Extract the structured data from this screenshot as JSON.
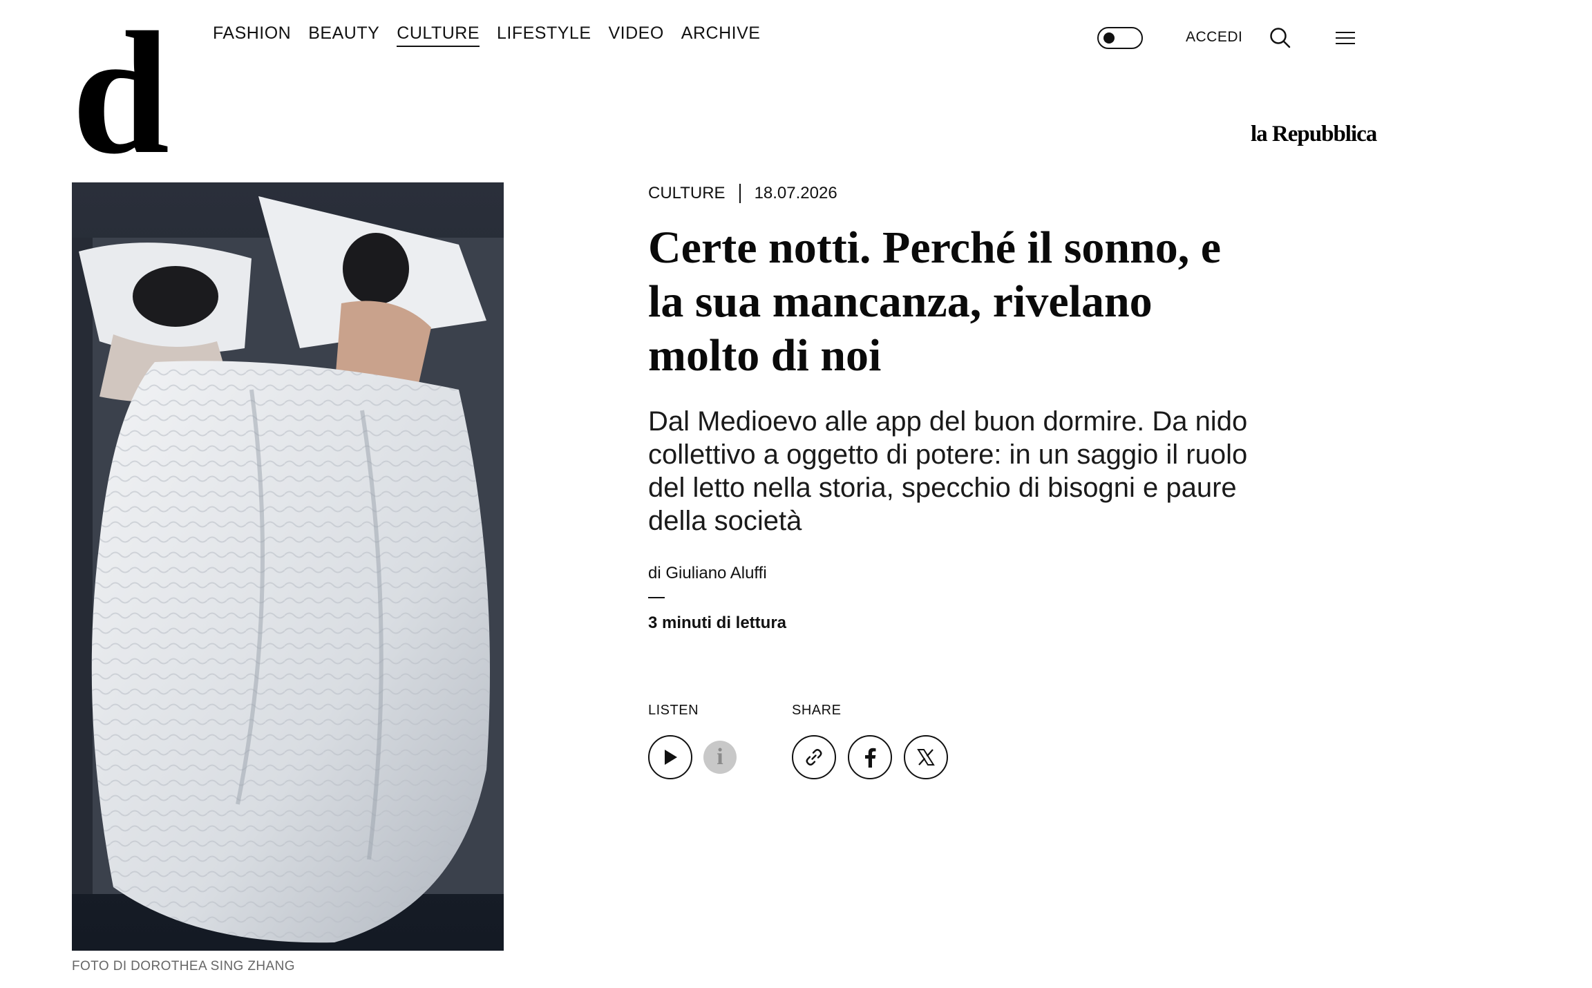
{
  "brand": {
    "logo_letter": "d",
    "partner": "la Repubblica"
  },
  "nav": {
    "items": [
      {
        "label": "FASHION",
        "active": false
      },
      {
        "label": "BEAUTY",
        "active": false
      },
      {
        "label": "CULTURE",
        "active": true
      },
      {
        "label": "LIFESTYLE",
        "active": false
      },
      {
        "label": "VIDEO",
        "active": false
      },
      {
        "label": "ARCHIVE",
        "active": false
      }
    ]
  },
  "toolbar": {
    "theme_toggle_icon": "toggle-icon",
    "login_label": "ACCEDI",
    "search_icon": "search-icon",
    "menu_icon": "hamburger-menu-icon"
  },
  "article": {
    "section": "CULTURE",
    "date": "18.07.2026",
    "headline": "Certe notti. Perché il sonno, e la sua mancanza, rivelano molto di noi",
    "subtitle": "Dal Medioevo alle app del buon dormire. Da nido collettivo a oggetto di potere: in un saggio il ruolo del letto nella storia, specchio di bisogni e paure della società",
    "author": "di Giuliano Aluffi",
    "read_time": "3 minuti di lettura",
    "image_caption": "FOTO DI DOROTHEA SING ZHANG"
  },
  "actions": {
    "listen_label": "LISTEN",
    "share_label": "SHARE",
    "info_glyph": "i",
    "play_icon": "play-icon",
    "info_icon": "info-icon",
    "share_icons": [
      "link-icon",
      "facebook-icon",
      "x-icon"
    ]
  },
  "colors": {
    "text": "#111111",
    "background": "#ffffff",
    "caption": "#666666",
    "info_button": "#c8c8c8"
  }
}
